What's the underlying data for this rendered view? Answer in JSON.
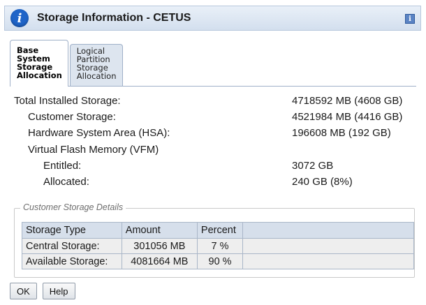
{
  "window": {
    "title": "Storage Information - CETUS",
    "icons": {
      "title_icon": "info-icon",
      "help_icon": "help-icon"
    }
  },
  "tabs": [
    {
      "label_lines": [
        "Base",
        "System",
        "Storage",
        "Allocation"
      ],
      "active": true
    },
    {
      "label_lines": [
        "Logical",
        "Partition",
        "Storage",
        "Allocation"
      ],
      "active": false
    }
  ],
  "storage": {
    "total": {
      "label": "Total Installed Storage:",
      "value": "4718592 MB (4608 GB)"
    },
    "customer": {
      "label": "Customer Storage:",
      "value": "4521984 MB (4416 GB)"
    },
    "hsa": {
      "label": "Hardware System Area (HSA):",
      "value": "196608 MB (192 GB)"
    },
    "vfm": {
      "label": "Virtual Flash Memory (VFM)"
    },
    "entitled": {
      "label": "Entitled:",
      "value": "3072 GB"
    },
    "allocated": {
      "label": "Allocated:",
      "value": "240 GB (8%)"
    }
  },
  "details": {
    "legend": "Customer Storage Details",
    "headers": [
      "Storage Type",
      "Amount",
      "Percent"
    ],
    "rows": [
      [
        "Central Storage:",
        "301056 MB",
        "7 %"
      ],
      [
        "Available Storage:",
        "4081664 MB",
        "90 %"
      ]
    ]
  },
  "buttons": {
    "ok": "OK",
    "help": "Help"
  },
  "colors": {
    "title_bar": "#d3dfee",
    "info_icon": "#1f64c8",
    "table_header": "#d6dfeb"
  }
}
